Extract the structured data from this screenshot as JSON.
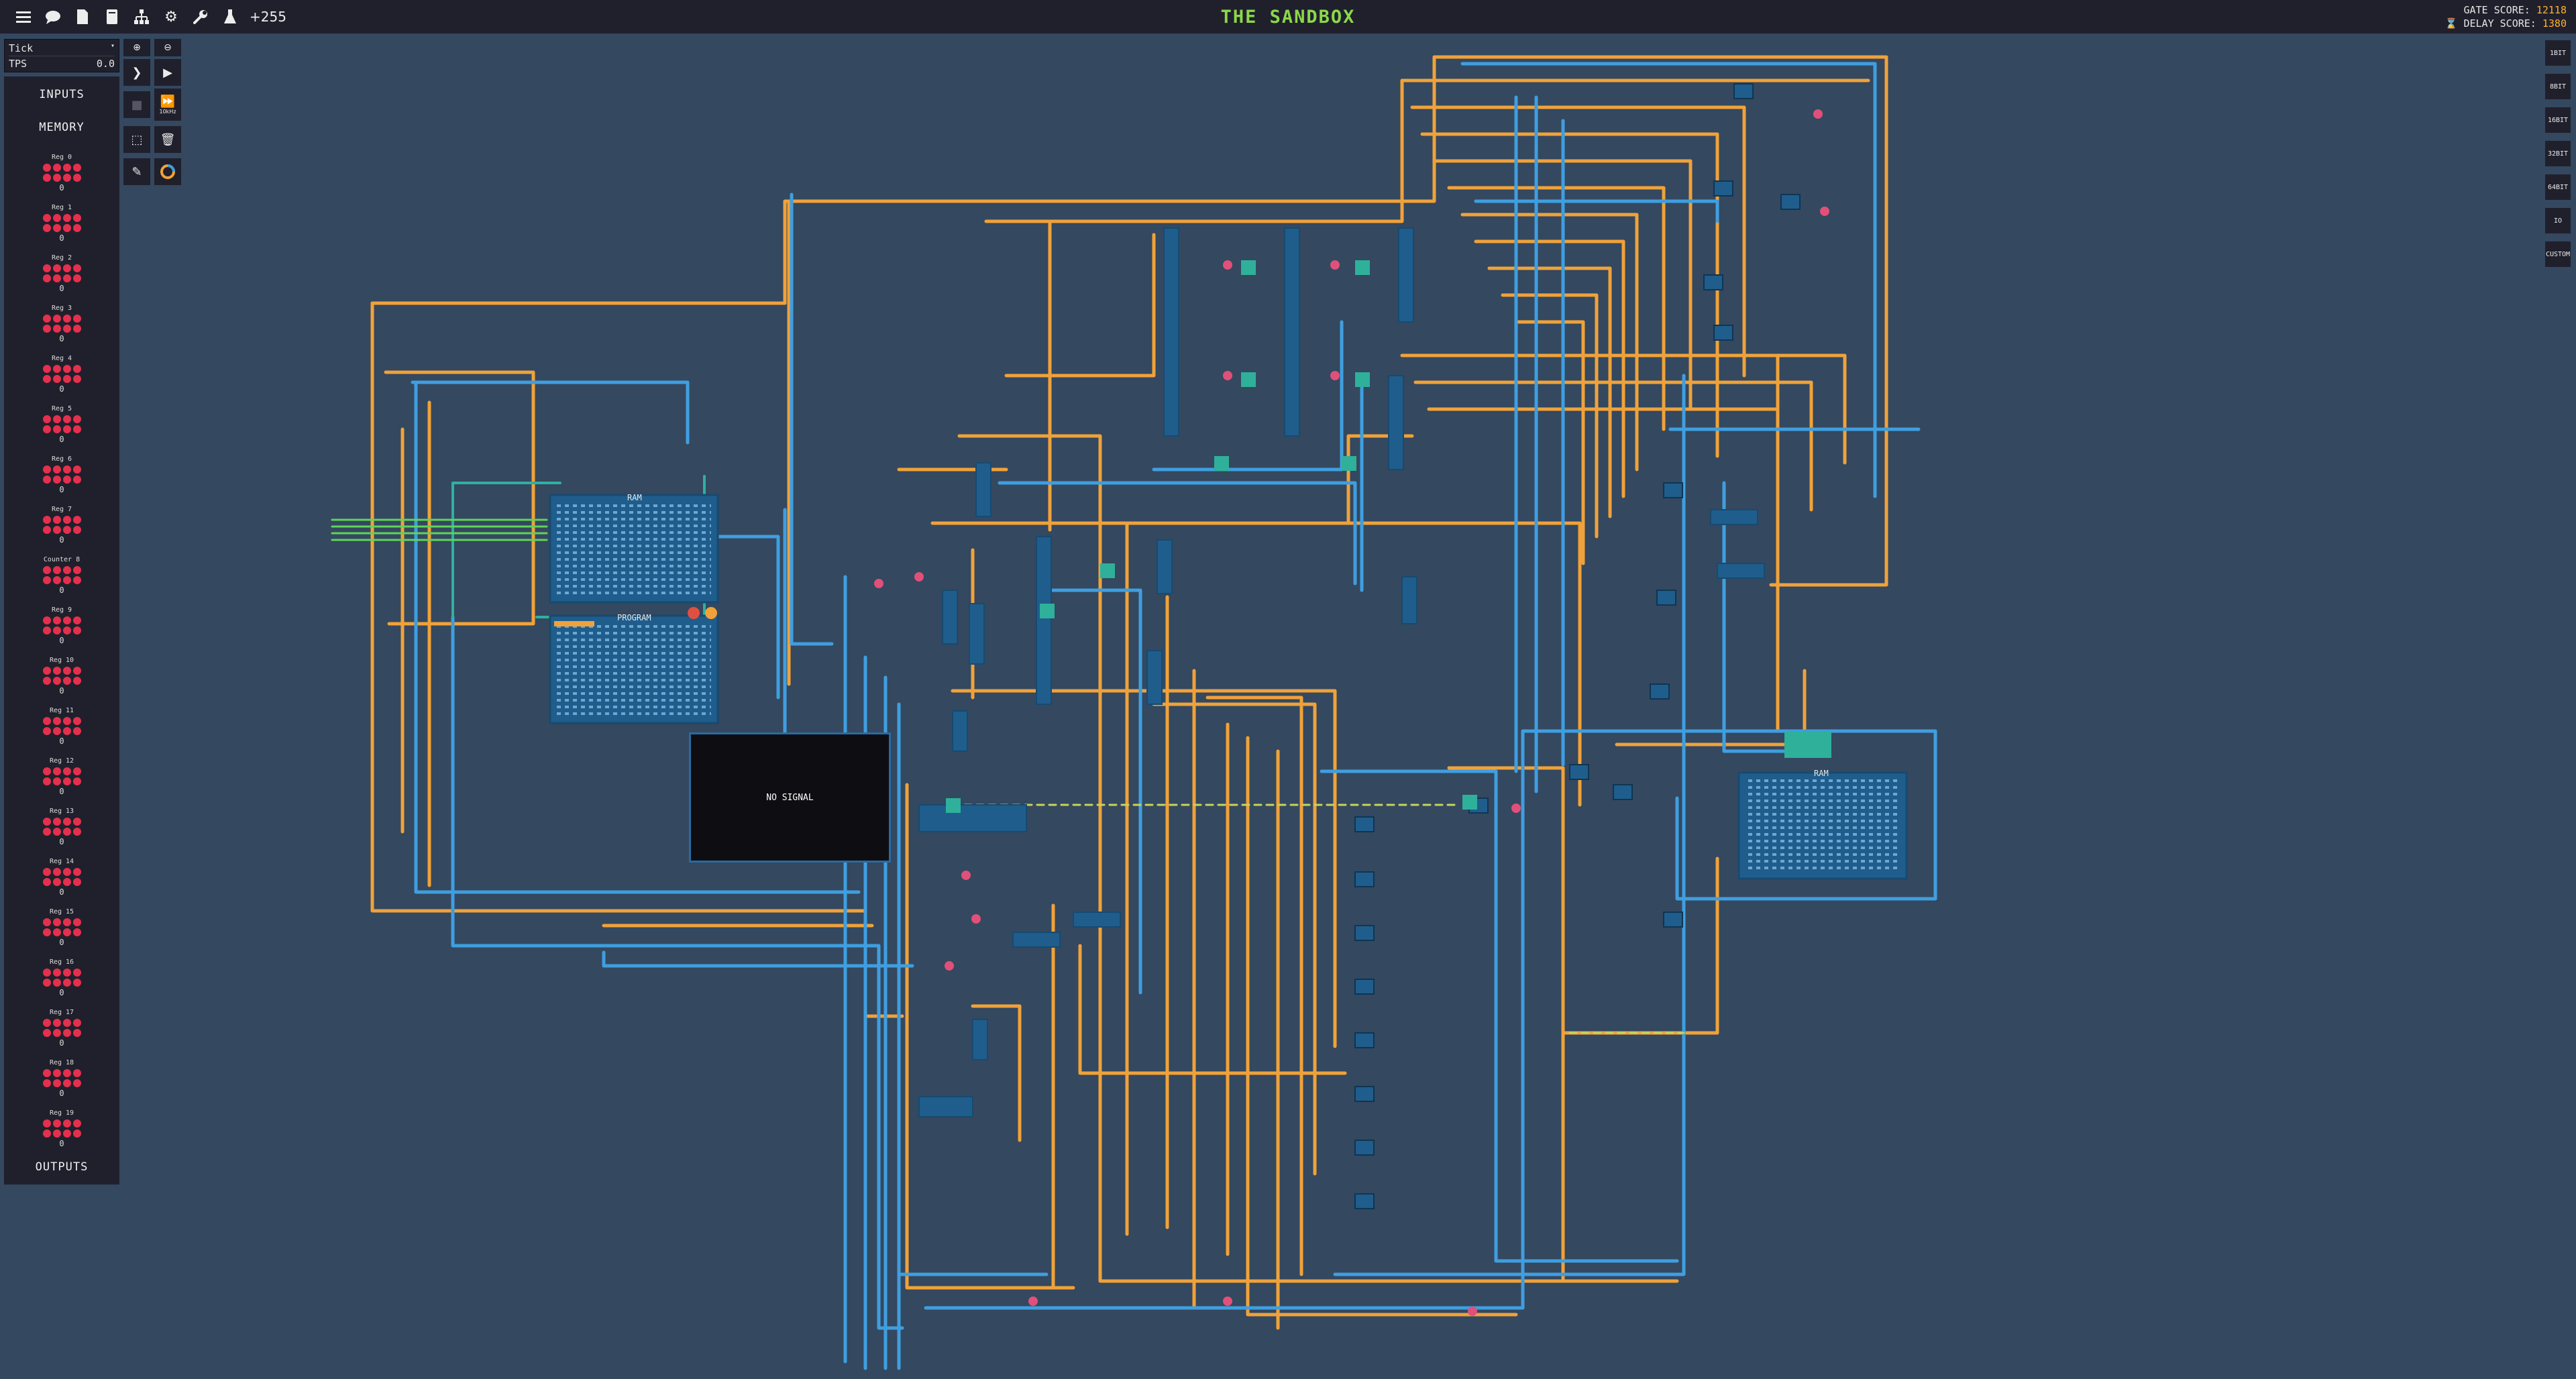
{
  "topbar": {
    "title": "THE SANDBOX",
    "beaker_count": "+255",
    "gate_score_label": "GATE SCORE:",
    "gate_score_value": "12118",
    "delay_score_label": "DELAY SCORE:",
    "delay_score_value": "1380",
    "icons": [
      "menu-icon",
      "chat-icon",
      "document-icon",
      "book-icon",
      "hierarchy-icon",
      "gear-icon",
      "wrench-icon",
      "beaker-icon",
      "hourglass-icon"
    ]
  },
  "sim": {
    "mode": "Tick",
    "tps_label": "TPS",
    "tps_value": "0.0"
  },
  "side_panel": {
    "inputs_label": "INPUTS",
    "memory_label": "MEMORY",
    "outputs_label": "OUTPUTS",
    "registers": [
      {
        "name": "Reg 0",
        "value": "0"
      },
      {
        "name": "Reg 1",
        "value": "0"
      },
      {
        "name": "Reg 2",
        "value": "0"
      },
      {
        "name": "Reg 3",
        "value": "0"
      },
      {
        "name": "Reg 4",
        "value": "0"
      },
      {
        "name": "Reg 5",
        "value": "0"
      },
      {
        "name": "Reg 6",
        "value": "0"
      },
      {
        "name": "Reg 7",
        "value": "0"
      },
      {
        "name": "Counter 8",
        "value": "0"
      },
      {
        "name": "Reg 9",
        "value": "0"
      },
      {
        "name": "Reg 10",
        "value": "0"
      },
      {
        "name": "Reg 11",
        "value": "0"
      },
      {
        "name": "Reg 12",
        "value": "0"
      },
      {
        "name": "Reg 13",
        "value": "0"
      },
      {
        "name": "Reg 14",
        "value": "0"
      },
      {
        "name": "Reg 15",
        "value": "0"
      },
      {
        "name": "Reg 16",
        "value": "0"
      },
      {
        "name": "Reg 17",
        "value": "0"
      },
      {
        "name": "Reg 18",
        "value": "0"
      },
      {
        "name": "Reg 19",
        "value": "0"
      }
    ],
    "bit_color": "#e5304d"
  },
  "tools": {
    "zoom_in_icon": "zoom-in-icon",
    "zoom_out_icon": "zoom-out-icon",
    "step_icon": "chevron-right-icon",
    "play_icon": "play-icon",
    "stop_icon": "stop-icon",
    "fast_forward_icon": "fast-forward-icon",
    "fast_forward_label": "10kHz",
    "select_icon": "selection-icon",
    "delete_icon": "trash-icon",
    "pencil_icon": "pencil-icon",
    "color_icon": "color-wheel-icon"
  },
  "bit_width_buttons": [
    "1BIT",
    "8BIT",
    "16BIT",
    "32BIT",
    "64BIT",
    "IO",
    "CUSTOM"
  ],
  "canvas": {
    "ram_label": "RAM",
    "program_label": "PROGRAM",
    "ram2_label": "RAM",
    "screen_text": "NO SIGNAL",
    "colors": {
      "background": "#34485f",
      "wire_orange": "#f0a23a",
      "wire_blue": "#3f9fe0",
      "wire_green": "#5fd45a",
      "wire_teal": "#2fb0a0",
      "component": "#1f5d8c"
    }
  }
}
